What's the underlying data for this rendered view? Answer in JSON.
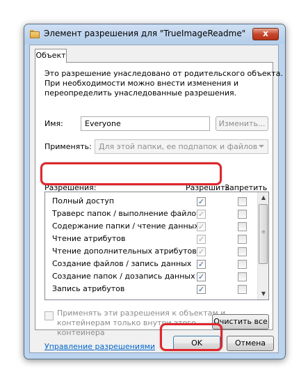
{
  "window": {
    "title": "Элемент разрешения для \"TrueImageReadme\"",
    "close_glyph": "x"
  },
  "tab": {
    "label": "Объект"
  },
  "info": {
    "lines": [
      "Это разрешение унаследовано от родительского объекта.",
      "При необходимости можно внести изменения и",
      "переопределить унаследованные разрешения."
    ]
  },
  "name_row": {
    "label": "Имя:",
    "value": "Everyone",
    "change_button": "Изменить..."
  },
  "apply_row": {
    "label": "Применять:",
    "selected": "Для этой папки, ее подпапок и файлов"
  },
  "permissions": {
    "header_name": "Разрешения:",
    "header_allow": "Разрешить",
    "header_deny": "Запретить",
    "rows": [
      {
        "name": "Полный доступ",
        "allow": "✓"
      },
      {
        "name": "Траверс папок / выполнение файлов",
        "allow": "✓"
      },
      {
        "name": "Содержание папки / чтение данных",
        "allow": "✓"
      },
      {
        "name": "Чтение атрибутов",
        "allow": "✓"
      },
      {
        "name": "Чтение дополнительных атрибутов",
        "allow": "✓"
      },
      {
        "name": "Создание файлов / запись данных",
        "allow": "✓"
      },
      {
        "name": "Создание папок / дозапись данных",
        "allow": "✓"
      },
      {
        "name": "Запись атрибутов",
        "allow": "✓"
      }
    ],
    "scroll_up": "▲",
    "scroll_down": "▼",
    "grip": "≡"
  },
  "apply_inside": {
    "lines": [
      "Применять эти разрешения к объектам и",
      "контейнерам только внутри этого",
      "контейнера"
    ]
  },
  "clear_all_button": "Очистить все",
  "manage_link": "Управление разрешениями",
  "ok_button": "OK",
  "cancel_button": "Отмена"
}
